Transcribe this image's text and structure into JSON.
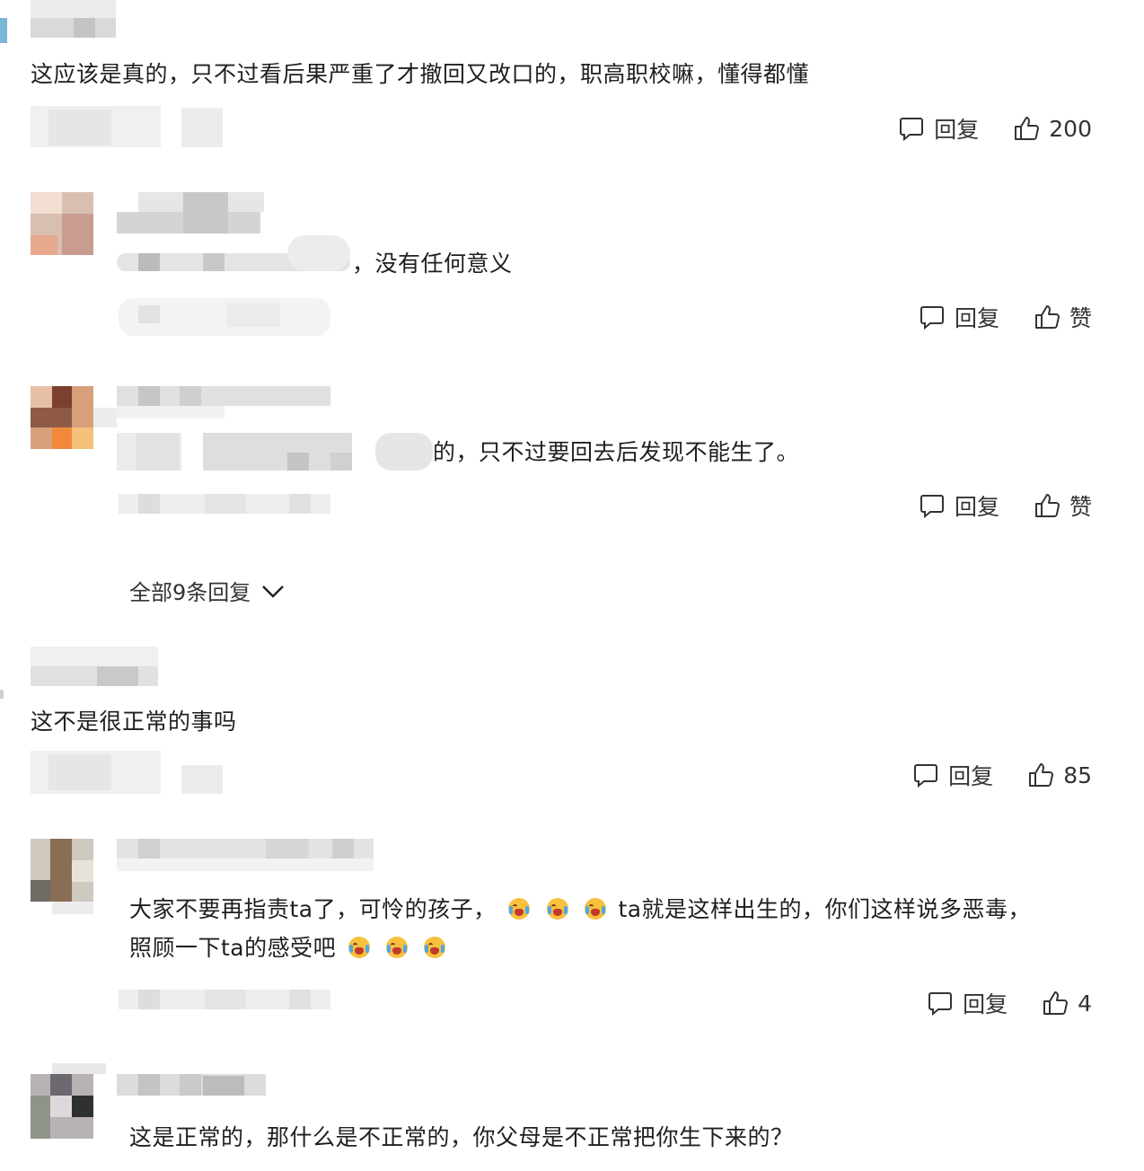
{
  "actions": {
    "reply_label": "回复"
  },
  "comments": [
    {
      "text": "这应该是真的，只不过看后果严重了才撤回又改口的，职高职校嘛，懂得都懂",
      "likes": "200"
    },
    {
      "text": "，没有任何意义",
      "likes": "赞"
    },
    {
      "text": "的，只不过要回去后发现不能生了。",
      "likes": "赞"
    },
    {
      "text": "这不是很正常的事吗",
      "likes": "85"
    },
    {
      "line1_a": "大家不要再指责ta了，可怜的孩子，",
      "line1_b": "ta就是这样出生的，你们这样说多恶毒，",
      "line2_a": "照顾一下ta的感受吧",
      "likes": "4"
    },
    {
      "text": "这是正常的，那什么是不正常的，你父母是不正常把你生下来的？"
    }
  ],
  "expand_replies": "全部9条回复",
  "icons": {
    "reply": "speech-bubble-icon",
    "like": "thumbs-up-icon",
    "chevron": "chevron-down-icon",
    "emoji": "crying-face-emoji"
  }
}
